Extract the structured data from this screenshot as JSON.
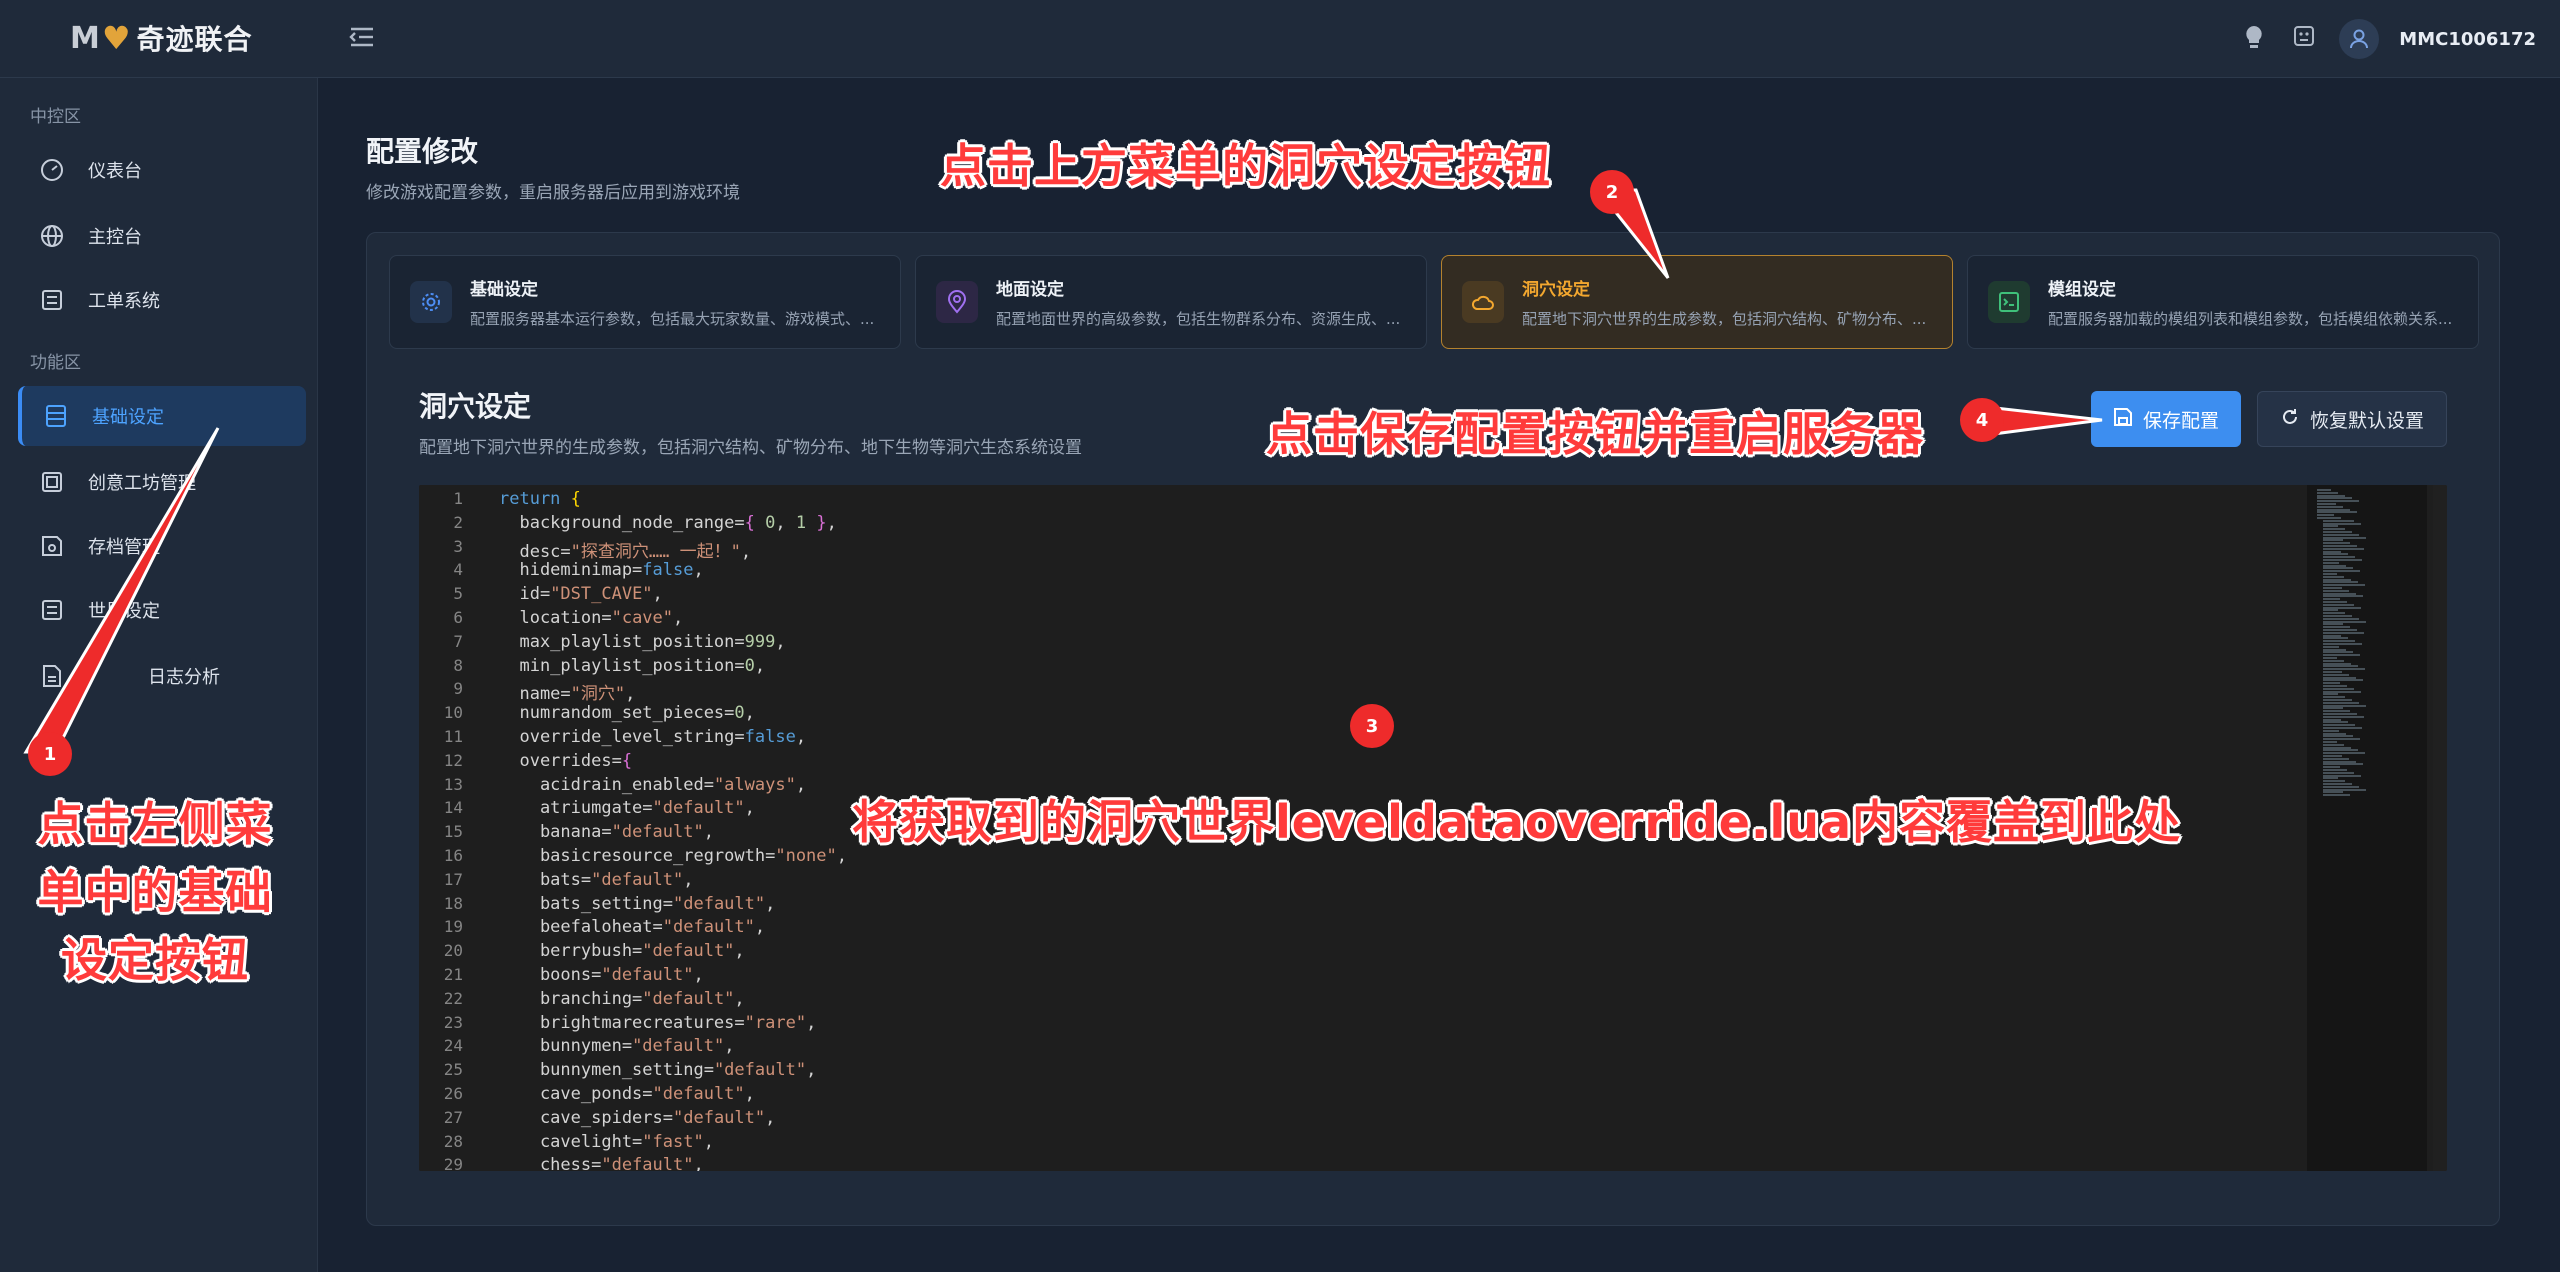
{
  "header": {
    "logo_mark": "M",
    "logo_text": "奇迹联合",
    "username": "MMC1006172"
  },
  "sidebar": {
    "section_control": "中控区",
    "section_function": "功能区",
    "items": [
      {
        "label": "仪表台",
        "icon": "dashboard-icon"
      },
      {
        "label": "主控台",
        "icon": "globe-icon"
      },
      {
        "label": "工单系统",
        "icon": "list-icon"
      },
      {
        "label": "基础设定",
        "icon": "table-icon"
      },
      {
        "label": "创意工坊管理",
        "icon": "workshop-icon"
      },
      {
        "label": "存档管理",
        "icon": "save-icon"
      },
      {
        "label": "世界设定",
        "icon": "list-icon"
      },
      {
        "label": "日志分析",
        "icon": "file-icon"
      }
    ]
  },
  "page": {
    "title": "配置修改",
    "subtitle": "修改游戏配置参数，重启服务器后应用到游戏环境"
  },
  "tabs": [
    {
      "title": "基础设定",
      "desc": "配置服务器基本运行参数，包括最大玩家数量、游戏模式、...",
      "icon": "gear-icon",
      "color": "#4d8ef5"
    },
    {
      "title": "地面设定",
      "desc": "配置地面世界的高级参数，包括生物群系分布、资源生成、...",
      "icon": "location-icon",
      "color": "#a070f0"
    },
    {
      "title": "洞穴设定",
      "desc": "配置地下洞穴世界的生成参数，包括洞穴结构、矿物分布、...",
      "icon": "cloud-icon",
      "color": "#f3a72f"
    },
    {
      "title": "模组设定",
      "desc": "配置服务器加载的模组列表和模组参数，包括模组依赖关系...",
      "icon": "terminal-icon",
      "color": "#3fc07a"
    }
  ],
  "section": {
    "title": "洞穴设定",
    "subtitle": "配置地下洞穴世界的生成参数，包括洞穴结构、矿物分布、地下生物等洞穴生态系统设置"
  },
  "buttons": {
    "save": "保存配置",
    "reset": "恢复默认设置"
  },
  "editor": {
    "line_numbers": [
      "1",
      "2",
      "3",
      "4",
      "5",
      "6",
      "7",
      "8",
      "9",
      "10",
      "11",
      "12",
      "13",
      "14",
      "15",
      "16",
      "17",
      "18",
      "19",
      "20",
      "21",
      "22",
      "23",
      "24",
      "25",
      "26",
      "27",
      "28",
      "29"
    ],
    "lines": [
      [
        {
          "t": "return ",
          "c": "kw"
        },
        {
          "t": "{",
          "c": "br"
        }
      ],
      [
        {
          "t": "  background_node_range=",
          "c": ""
        },
        {
          "t": "{",
          "c": "brp"
        },
        {
          "t": " 0",
          "c": "num"
        },
        {
          "t": ", ",
          "c": ""
        },
        {
          "t": "1",
          "c": "num"
        },
        {
          "t": " }",
          "c": "brp"
        },
        {
          "t": ",",
          "c": ""
        }
      ],
      [
        {
          "t": "  desc=",
          "c": ""
        },
        {
          "t": "\"探查洞穴…… 一起！\"",
          "c": "str"
        },
        {
          "t": ",",
          "c": ""
        }
      ],
      [
        {
          "t": "  hideminimap=",
          "c": ""
        },
        {
          "t": "false",
          "c": "kw"
        },
        {
          "t": ",",
          "c": ""
        }
      ],
      [
        {
          "t": "  id=",
          "c": ""
        },
        {
          "t": "\"DST_CAVE\"",
          "c": "str"
        },
        {
          "t": ",",
          "c": ""
        }
      ],
      [
        {
          "t": "  location=",
          "c": ""
        },
        {
          "t": "\"cave\"",
          "c": "str"
        },
        {
          "t": ",",
          "c": ""
        }
      ],
      [
        {
          "t": "  max_playlist_position=",
          "c": ""
        },
        {
          "t": "999",
          "c": "num"
        },
        {
          "t": ",",
          "c": ""
        }
      ],
      [
        {
          "t": "  min_playlist_position=",
          "c": ""
        },
        {
          "t": "0",
          "c": "num"
        },
        {
          "t": ",",
          "c": ""
        }
      ],
      [
        {
          "t": "  name=",
          "c": ""
        },
        {
          "t": "\"洞穴\"",
          "c": "str"
        },
        {
          "t": ",",
          "c": ""
        }
      ],
      [
        {
          "t": "  numrandom_set_pieces=",
          "c": ""
        },
        {
          "t": "0",
          "c": "num"
        },
        {
          "t": ",",
          "c": ""
        }
      ],
      [
        {
          "t": "  override_level_string=",
          "c": ""
        },
        {
          "t": "false",
          "c": "kw"
        },
        {
          "t": ",",
          "c": ""
        }
      ],
      [
        {
          "t": "  overrides=",
          "c": ""
        },
        {
          "t": "{",
          "c": "brp"
        }
      ],
      [
        {
          "t": "    acidrain_enabled=",
          "c": ""
        },
        {
          "t": "\"always\"",
          "c": "str"
        },
        {
          "t": ",",
          "c": ""
        }
      ],
      [
        {
          "t": "    atriumgate=",
          "c": ""
        },
        {
          "t": "\"default\"",
          "c": "str"
        },
        {
          "t": ",",
          "c": ""
        }
      ],
      [
        {
          "t": "    banana=",
          "c": ""
        },
        {
          "t": "\"default\"",
          "c": "str"
        },
        {
          "t": ",",
          "c": ""
        }
      ],
      [
        {
          "t": "    basicresource_regrowth=",
          "c": ""
        },
        {
          "t": "\"none\"",
          "c": "str"
        },
        {
          "t": ",",
          "c": ""
        }
      ],
      [
        {
          "t": "    bats=",
          "c": ""
        },
        {
          "t": "\"default\"",
          "c": "str"
        },
        {
          "t": ",",
          "c": ""
        }
      ],
      [
        {
          "t": "    bats_setting=",
          "c": ""
        },
        {
          "t": "\"default\"",
          "c": "str"
        },
        {
          "t": ",",
          "c": ""
        }
      ],
      [
        {
          "t": "    beefaloheat=",
          "c": ""
        },
        {
          "t": "\"default\"",
          "c": "str"
        },
        {
          "t": ",",
          "c": ""
        }
      ],
      [
        {
          "t": "    berrybush=",
          "c": ""
        },
        {
          "t": "\"default\"",
          "c": "str"
        },
        {
          "t": ",",
          "c": ""
        }
      ],
      [
        {
          "t": "    boons=",
          "c": ""
        },
        {
          "t": "\"default\"",
          "c": "str"
        },
        {
          "t": ",",
          "c": ""
        }
      ],
      [
        {
          "t": "    branching=",
          "c": ""
        },
        {
          "t": "\"default\"",
          "c": "str"
        },
        {
          "t": ",",
          "c": ""
        }
      ],
      [
        {
          "t": "    brightmarecreatures=",
          "c": ""
        },
        {
          "t": "\"rare\"",
          "c": "str"
        },
        {
          "t": ",",
          "c": ""
        }
      ],
      [
        {
          "t": "    bunnymen=",
          "c": ""
        },
        {
          "t": "\"default\"",
          "c": "str"
        },
        {
          "t": ",",
          "c": ""
        }
      ],
      [
        {
          "t": "    bunnymen_setting=",
          "c": ""
        },
        {
          "t": "\"default\"",
          "c": "str"
        },
        {
          "t": ",",
          "c": ""
        }
      ],
      [
        {
          "t": "    cave_ponds=",
          "c": ""
        },
        {
          "t": "\"default\"",
          "c": "str"
        },
        {
          "t": ",",
          "c": ""
        }
      ],
      [
        {
          "t": "    cave_spiders=",
          "c": ""
        },
        {
          "t": "\"default\"",
          "c": "str"
        },
        {
          "t": ",",
          "c": ""
        }
      ],
      [
        {
          "t": "    cavelight=",
          "c": ""
        },
        {
          "t": "\"fast\"",
          "c": "str"
        },
        {
          "t": ",",
          "c": ""
        }
      ],
      [
        {
          "t": "    chess=",
          "c": ""
        },
        {
          "t": "\"default\"",
          "c": "str"
        },
        {
          "t": ",",
          "c": ""
        }
      ]
    ]
  },
  "annotations": {
    "a1": "点击左侧菜单中的基础设定按钮",
    "a1_lines": [
      "点击左侧菜",
      "单中的基础",
      "设定按钮"
    ],
    "a2": "点击上方菜单的洞穴设定按钮",
    "a3": "将获取到的洞穴世界leveldataoverride.lua内容覆盖到此处",
    "a4": "点击保存配置按钮并重启服务器",
    "b1": "1",
    "b2": "2",
    "b3": "3",
    "b4": "4"
  }
}
